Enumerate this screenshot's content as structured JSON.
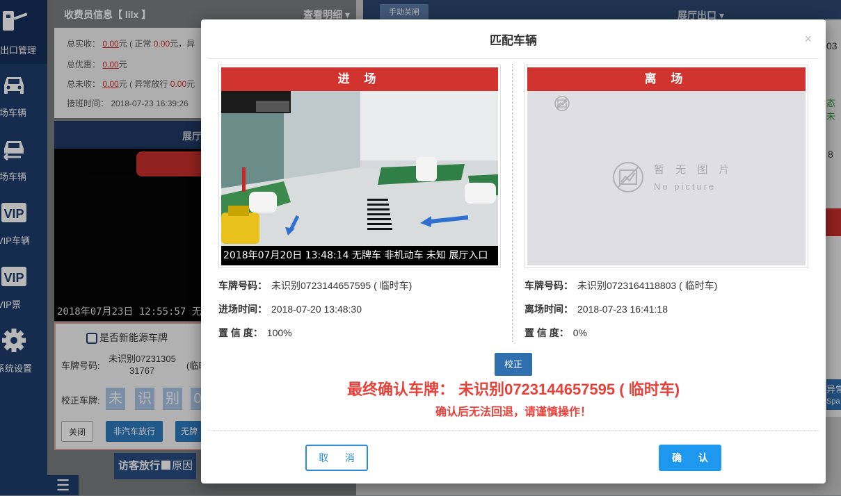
{
  "sidebar": {
    "items": [
      {
        "label": "出口管理",
        "icon": "barrier-gate-icon"
      },
      {
        "label": "在场车辆",
        "icon": "car-icon"
      },
      {
        "label": "离场车辆",
        "icon": "car-exit-icon"
      },
      {
        "label": "VIP车辆",
        "icon": "vip-icon"
      },
      {
        "label": "VIP票",
        "icon": "vip-ticket-icon"
      },
      {
        "label": "系统设置",
        "icon": "gear-icon"
      }
    ]
  },
  "cashier": {
    "title": "收费员信息【 lilx 】",
    "detail_label": "查看明细",
    "total_received_label": "总实收：",
    "total_received_value": "0.00",
    "total_received_unit": "元",
    "normal_label": "( 正常",
    "normal_value": "0.00",
    "normal_unit": "元，异",
    "total_discount_label": "总优惠：",
    "total_discount_value": "0.00",
    "total_discount_unit": "元",
    "total_unpaid_label": "总未收：",
    "total_unpaid_value": "0.00",
    "total_unpaid_unit": "元",
    "abnormal_label": "( 异常放行",
    "abnormal_value": "0.00",
    "abnormal_unit": "元",
    "shift_time_label": "接班时间：",
    "shift_time_value": "2018-07-23 16:39:26"
  },
  "entry_panel": {
    "title": "展厅进口",
    "video_osd": "2018年07月23日  12:55:57 无牌车"
  },
  "plate_form": {
    "new_energy_label": "是否新能源车牌",
    "plate_no_label": "车牌号码:",
    "plate_no_value_1": "未识别07231305",
    "plate_no_value_2": "31767",
    "plate_note": "(临时",
    "correct_label": "校正车牌:",
    "chars": [
      "未",
      "识",
      "别",
      "0"
    ],
    "close_label": "关闭",
    "non_vehicle_label": "非汽车放行",
    "no_plate_label": "无牌"
  },
  "visitor": {
    "label": "访客放行",
    "reason": "原因"
  },
  "exit_panel": {
    "manual_close_label": "手动关闸",
    "title": "展厅出口"
  },
  "modal": {
    "title": "匹配车辆",
    "close_icon": "×",
    "entry": {
      "banner": "进 场",
      "photo_caption": "2018年07月20日 13:48:14 无牌车 非机动车 未知 展厅入口",
      "plate_label": "车牌号码：",
      "plate_value": "未识别0723144657595 ( 临时车)",
      "time_label": "进场时间：",
      "time_value": "2018-07-20 13:48:30",
      "confidence_label": "置 信 度：",
      "confidence_value": "100%"
    },
    "exit": {
      "banner": "离 场",
      "no_picture_cn": "暂 无 图 片",
      "no_picture_en": "No picture",
      "plate_label": "车牌号码：",
      "plate_value": "未识别0723164118803 ( 临时车)",
      "time_label": "离场时间：",
      "time_value": "2018-07-23 16:41:18",
      "confidence_label": "置 信 度：",
      "confidence_value": "0%"
    },
    "verify_label": "校正",
    "final_plate": "最终确认车牌： 未识别0723144657595 ( 临时车)",
    "warning": "确认后无法回退，请谨慎操作！",
    "cancel_label": "取 消",
    "confirm_label": "确 认"
  },
  "edge_texts": [
    "03",
    "态未",
    "8",
    "异常",
    "Spa"
  ],
  "colors": {
    "sidebar": "#1e3d6d",
    "banner_red": "#d1342e",
    "warning_red": "#e8413a",
    "primary_blue": "#1e97ee"
  }
}
